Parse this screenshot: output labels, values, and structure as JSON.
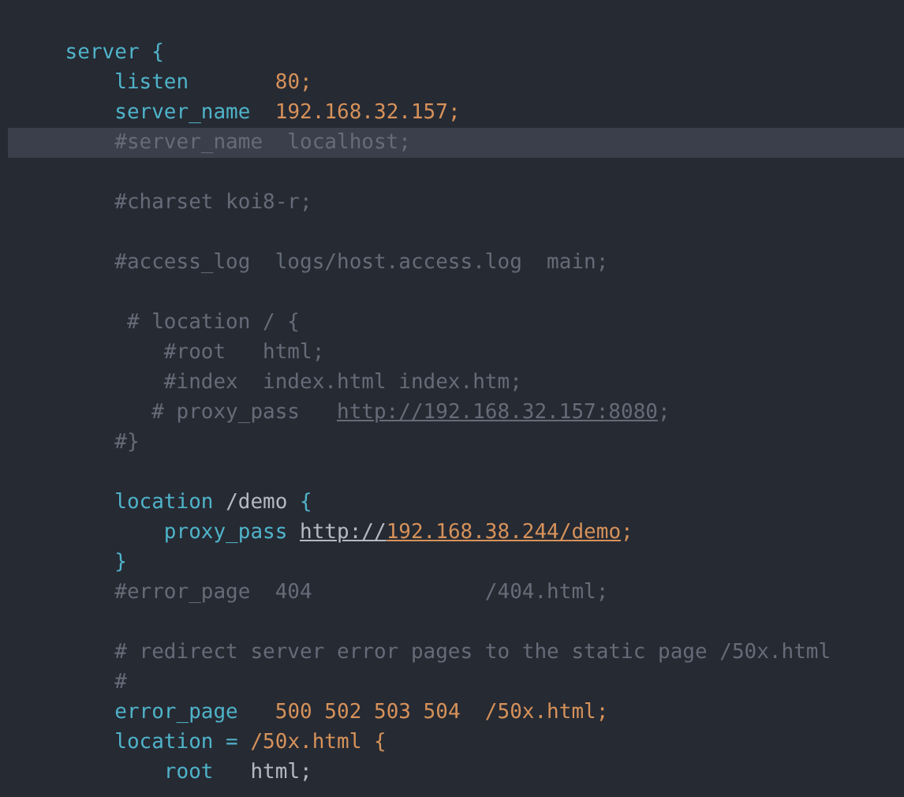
{
  "editor": {
    "lines": [
      {
        "kind": "code",
        "highlighted": false,
        "segments": [
          {
            "text": "    server ",
            "kind": "keyword"
          },
          {
            "text": "{",
            "kind": "keyword"
          }
        ]
      },
      {
        "kind": "code",
        "highlighted": false,
        "segments": [
          {
            "text": "        listen       ",
            "kind": "keyword"
          },
          {
            "text": "80;",
            "kind": "value"
          }
        ]
      },
      {
        "kind": "code",
        "highlighted": false,
        "segments": [
          {
            "text": "        server_name  ",
            "kind": "keyword"
          },
          {
            "text": "192.168.32.157;",
            "kind": "value"
          }
        ]
      },
      {
        "kind": "code",
        "highlighted": true,
        "segments": [
          {
            "text": "        #server_name  localhost;",
            "kind": "comment"
          }
        ]
      },
      {
        "kind": "blank"
      },
      {
        "kind": "code",
        "highlighted": false,
        "segments": [
          {
            "text": "        #charset koi8-r;",
            "kind": "comment"
          }
        ]
      },
      {
        "kind": "blank"
      },
      {
        "kind": "code",
        "highlighted": false,
        "segments": [
          {
            "text": "        #access_log  logs/host.access.log  main;",
            "kind": "comment"
          }
        ]
      },
      {
        "kind": "blank"
      },
      {
        "kind": "code",
        "highlighted": false,
        "segments": [
          {
            "text": "         # location / {",
            "kind": "comment"
          }
        ]
      },
      {
        "kind": "code",
        "highlighted": false,
        "segments": [
          {
            "text": "            #root   html;",
            "kind": "comment"
          }
        ]
      },
      {
        "kind": "code",
        "highlighted": false,
        "segments": [
          {
            "text": "            #index  index.html index.htm;",
            "kind": "comment"
          }
        ]
      },
      {
        "kind": "code",
        "highlighted": false,
        "segments": [
          {
            "text": "           # proxy_pass   ",
            "kind": "comment"
          },
          {
            "text": "http://192.168.32.157:8080",
            "kind": "comment-url"
          },
          {
            "text": ";",
            "kind": "comment"
          }
        ]
      },
      {
        "kind": "code",
        "highlighted": false,
        "segments": [
          {
            "text": "        #}",
            "kind": "comment"
          }
        ]
      },
      {
        "kind": "blank"
      },
      {
        "kind": "code",
        "highlighted": false,
        "segments": [
          {
            "text": "        location ",
            "kind": "keyword"
          },
          {
            "text": "/demo ",
            "kind": "plain"
          },
          {
            "text": "{",
            "kind": "keyword"
          }
        ]
      },
      {
        "kind": "code",
        "highlighted": false,
        "segments": [
          {
            "text": "            proxy_pass ",
            "kind": "keyword"
          },
          {
            "text": "http://",
            "kind": "url-plain"
          },
          {
            "text": "192.168.38.244/demo",
            "kind": "url"
          },
          {
            "text": ";",
            "kind": "value"
          }
        ]
      },
      {
        "kind": "code",
        "highlighted": false,
        "segments": [
          {
            "text": "        }",
            "kind": "keyword"
          }
        ]
      },
      {
        "kind": "code",
        "highlighted": false,
        "segments": [
          {
            "text": "        #error_page  404              /404.html;",
            "kind": "comment"
          }
        ]
      },
      {
        "kind": "blank"
      },
      {
        "kind": "code",
        "highlighted": false,
        "segments": [
          {
            "text": "        # redirect server error pages to the static page /50x.html",
            "kind": "comment"
          }
        ]
      },
      {
        "kind": "code",
        "highlighted": false,
        "segments": [
          {
            "text": "        #",
            "kind": "comment"
          }
        ]
      },
      {
        "kind": "code",
        "highlighted": false,
        "segments": [
          {
            "text": "        error_page   ",
            "kind": "keyword"
          },
          {
            "text": "500 502 503 504  /50x.html;",
            "kind": "value"
          }
        ]
      },
      {
        "kind": "code",
        "highlighted": false,
        "segments": [
          {
            "text": "        location = ",
            "kind": "keyword"
          },
          {
            "text": "/50x.html {",
            "kind": "value"
          }
        ]
      },
      {
        "kind": "code",
        "highlighted": false,
        "segments": [
          {
            "text": "            root   ",
            "kind": "keyword"
          },
          {
            "text": "html;",
            "kind": "plain"
          }
        ]
      }
    ]
  }
}
